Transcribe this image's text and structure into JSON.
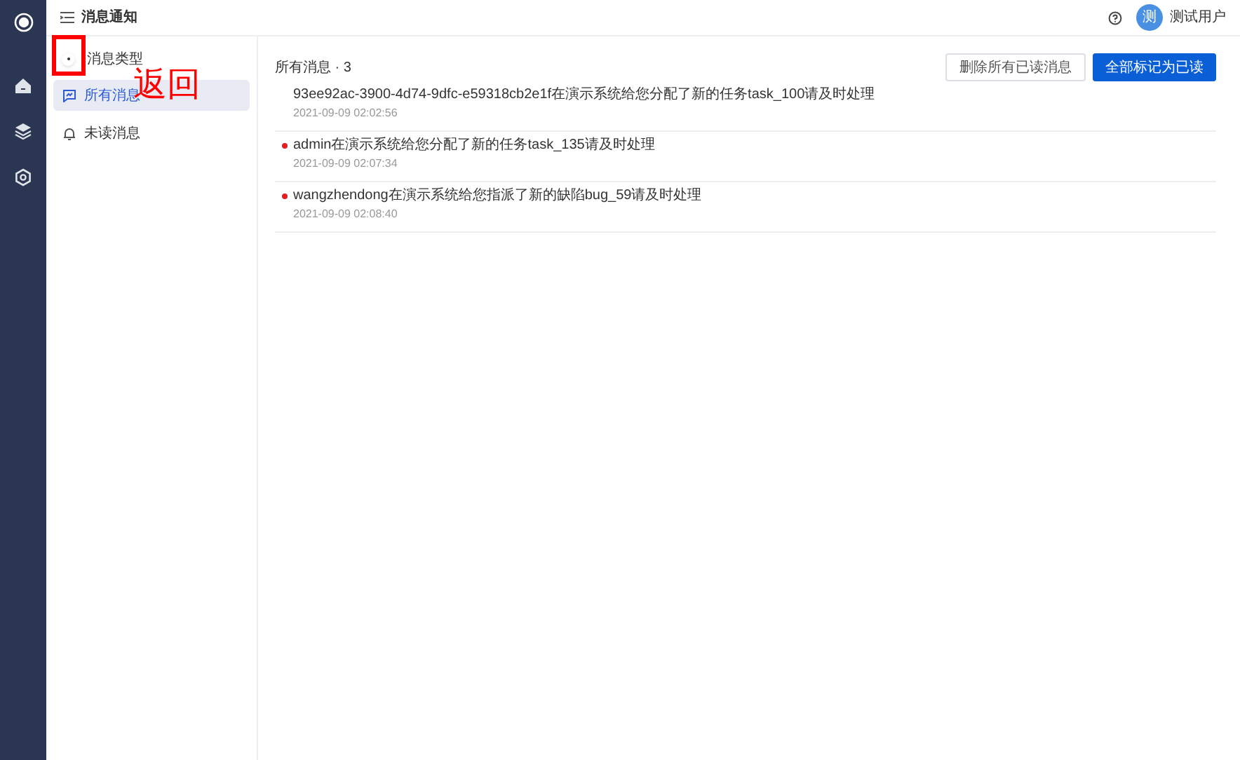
{
  "header": {
    "title": "消息通知",
    "user": {
      "avatar": "测",
      "name": "测试用户"
    }
  },
  "nav": [
    {
      "kind": "logo"
    },
    {
      "kind": "home"
    },
    {
      "kind": "layers"
    },
    {
      "kind": "settings"
    }
  ],
  "sidebar": {
    "title": "消息类型",
    "items": [
      {
        "label": "所有消息",
        "kind": "chat",
        "selected": true
      },
      {
        "label": "未读消息",
        "kind": "bell",
        "selected": false
      }
    ]
  },
  "main": {
    "title": "所有消息 · 3",
    "buttons": [
      {
        "label": "删除所有已读消息",
        "kind": "default"
      },
      {
        "label": "全部标记为已读",
        "kind": "primary"
      }
    ],
    "messages": [
      {
        "text": "93ee92ac-3900-4d74-9dfc-e59318cb2e1f在演示系统给您分配了新的任务task_100请及时处理",
        "time": "2021-09-09 02:02:56",
        "unread": false
      },
      {
        "text": "admin在演示系统给您分配了新的任务task_135请及时处理",
        "time": "2021-09-09 02:07:34",
        "unread": true
      },
      {
        "text": "wangzhendong在演示系统给您指派了新的缺陷bug_59请及时处理",
        "time": "2021-09-09 02:08:40",
        "unread": true
      }
    ]
  },
  "annotation": {
    "text": "返回"
  }
}
